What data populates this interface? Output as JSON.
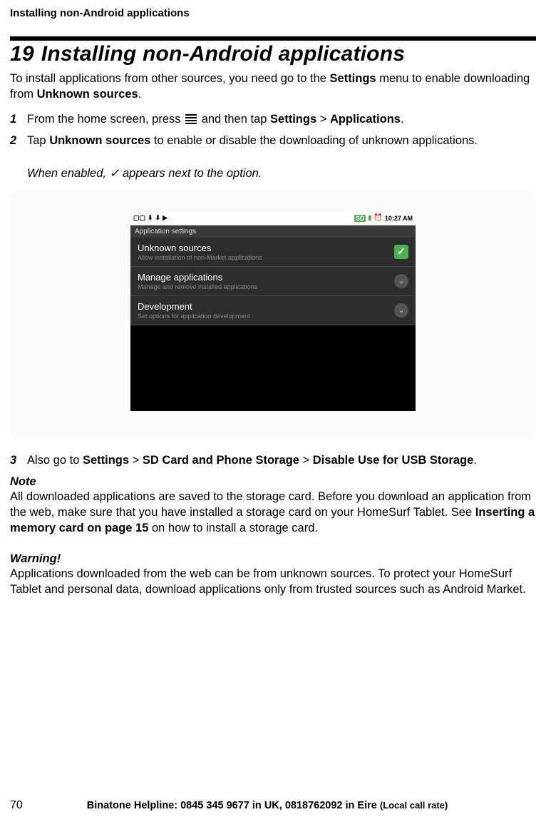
{
  "header": {
    "running_head": "Installing non-Android applications"
  },
  "chapter": {
    "number": "19",
    "title": "Installing non-Android applications"
  },
  "intro": {
    "text_a": "To install applications from other sources, you need go to the ",
    "settings": "Settings",
    "text_b": " menu to enable downloading from ",
    "unknown": "Unknown sources",
    "text_c": "."
  },
  "steps": {
    "s1": {
      "num": "1",
      "a": "From the home screen, press ",
      "b": " and then tap ",
      "settings": "Settings",
      "gt1": " > ",
      "apps": "Applications",
      "c": "."
    },
    "s2": {
      "num": "2",
      "a": "Tap ",
      "unknown": "Unknown sources",
      "b": " to enable or disable the downloading of unknown applications.",
      "sub_a": "When enabled, ",
      "check": "✓",
      "sub_b": " appears next to the option."
    },
    "s3": {
      "num": "3",
      "a": "Also go to ",
      "settings": "Settings",
      "gt1": " > ",
      "sd": "SD Card and Phone Storage",
      "gt2": " > ",
      "disable": "Disable Use for USB Storage",
      "b": "."
    }
  },
  "screenshot": {
    "status_time": "10:27 AM",
    "titlebar": "Application settings",
    "rows": [
      {
        "title": "Unknown sources",
        "sub": "Allow installation of non-Market applications"
      },
      {
        "title": "Manage applications",
        "sub": "Manage and remove installed applications"
      },
      {
        "title": "Development",
        "sub": "Set options for application development"
      }
    ]
  },
  "note": {
    "head": "Note",
    "a": "All downloaded applications are saved to the storage card. Before you download an application from the web, make sure that you have installed a storage card on your HomeSurf Tablet. See ",
    "ref": "Inserting a memory card on page 15",
    "b": " on how to install a storage card."
  },
  "warning": {
    "head": "Warning!",
    "text": "Applications downloaded from the web can be from unknown sources. To protect your HomeSurf Tablet and personal data, download applications only from trusted sources such as Android Market."
  },
  "footer": {
    "pagenum": "70",
    "helpline": "Binatone Helpline: 0845 345 9677 in UK, 0818762092 in Eire ",
    "rate": "(Local call rate)"
  }
}
